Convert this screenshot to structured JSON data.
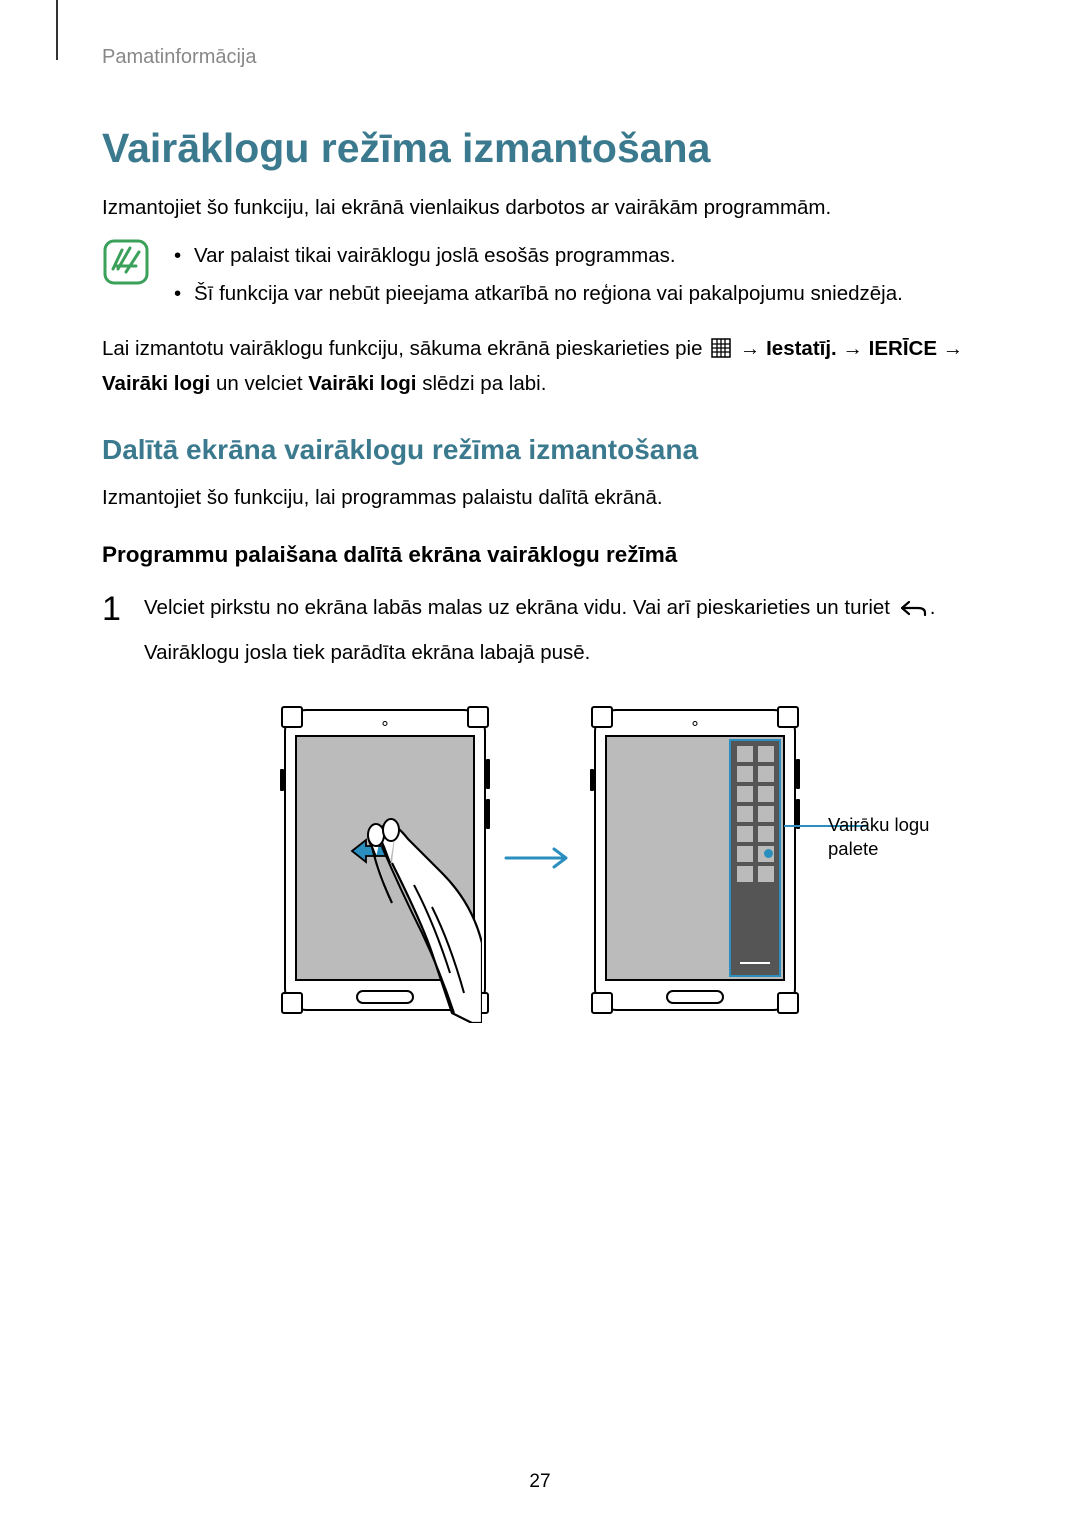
{
  "header": {
    "breadcrumb": "Pamatinformācija"
  },
  "title": "Vairāklogu režīma izmantošana",
  "intro": "Izmantojiet šo funkciju, lai ekrānā vienlaikus darbotos ar vairākām programmām.",
  "note": {
    "items": [
      "Var palaist tikai vairāklogu joslā esošās programmas.",
      "Šī funkcija var nebūt pieejama atkarībā no reģiona vai pakalpojumu sniedzēja."
    ]
  },
  "path": {
    "prefix": "Lai izmantotu vairāklogu funkciju, sākuma ekrānā pieskarieties pie ",
    "arrow": " → ",
    "step1_bold": "Iestatīj.",
    "step2_bold": "IERĪCE",
    "line2_a": "Vairāki logi",
    "line2_b": " un velciet ",
    "line2_c": "Vairāki logi",
    "line2_d": " slēdzi pa labi."
  },
  "section2": {
    "heading": "Dalītā ekrāna vairāklogu režīma izmantošana",
    "body": "Izmantojiet šo funkciju, lai programmas palaistu dalītā ekrānā."
  },
  "section3": {
    "heading": "Programmu palaišana dalītā ekrāna vairāklogu režīmā"
  },
  "step1": {
    "number": "1",
    "line1_a": "Velciet pirkstu no ekrāna labās malas uz ekrāna vidu. Vai arī pieskarieties un turiet ",
    "line1_b": ".",
    "line2": "Vairāklogu josla tiek parādīta ekrāna labajā pusē."
  },
  "figure": {
    "callout": "Vairāku logu\npalete",
    "callout_line1": "Vairāku logu",
    "callout_line2": "palete"
  },
  "page_number": "27"
}
